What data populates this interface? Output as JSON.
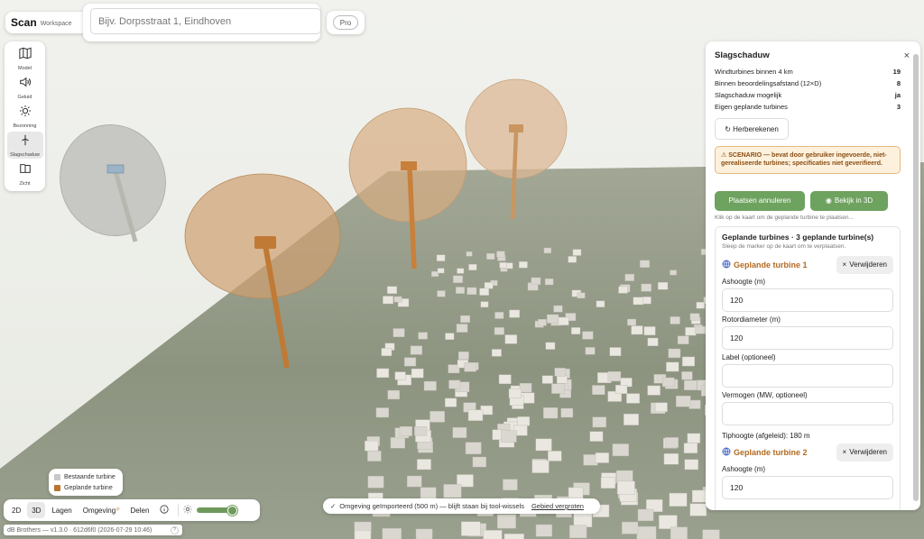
{
  "app": {
    "name": "Scan",
    "subtitle": "Workspace",
    "pro_label": "Pro"
  },
  "search": {
    "placeholder": "Bijv. Dorpsstraat 1, Eindhoven",
    "value": ""
  },
  "left_nav": [
    {
      "label": "Model",
      "icon": "map-icon"
    },
    {
      "label": "Geluid",
      "icon": "speaker-icon"
    },
    {
      "label": "Bezonning",
      "icon": "sun-icon"
    },
    {
      "label": "Slagschaduw",
      "icon": "wind-turbine-icon",
      "active": true
    },
    {
      "label": "Zicht",
      "icon": "map-view-icon"
    }
  ],
  "legend": [
    {
      "label": "Bestaande turbine",
      "color": "#c8c8c8"
    },
    {
      "label": "Geplande turbine",
      "color": "#b8752e"
    }
  ],
  "toolbar": {
    "buttons": [
      "2D",
      "3D",
      "Lagen",
      "Omgeving",
      "Delen"
    ],
    "active": "3D",
    "omgeving_badge": "P"
  },
  "version": "dB Brothers — v1.3.0 · 612d6f0 (2026-07-29 10:46)",
  "version_help": "?",
  "toast": {
    "icon": "✓",
    "text": "Omgeving geïmporteerd (500 m) — blijft staan bij tool-wissels",
    "link": "Gebied vergroten"
  },
  "panel": {
    "title": "Slagschaduw",
    "close": "×",
    "stats": [
      {
        "label": "Windturbines binnen 4 km",
        "value": "19"
      },
      {
        "label": "Binnen beoordelingsafstand (12×D)",
        "value": "8"
      },
      {
        "label": "Slagschaduw mogelijk",
        "value": "ja"
      },
      {
        "label": "Eigen geplande turbines",
        "value": "3"
      }
    ],
    "recalc": "↻ Herberekenen",
    "warning": "⚠ SCENARIO — bevat door gebruiker ingevoerde, niet-gerealiseerde turbines; specificaties niet geverifieerd.",
    "cancel_placing": "Plaatsen annuleren",
    "view_3d": "Bekijk in 3D",
    "hint": "Klik op de kaart om de geplande turbine te plaatsen...",
    "planned_title": "Geplande turbines · 3 geplande turbine(s)",
    "planned_sub": "Sleep de marker op de kaart om te verplaatsen.",
    "turbines": [
      {
        "name": "Geplande turbine 1",
        "delete": "Verwijderen",
        "hub_label": "Ashoogte (m)",
        "hub_value": "120",
        "rotor_label": "Rotordiameter (m)",
        "rotor_value": "120",
        "label_label": "Label (optioneel)",
        "label_value": "",
        "power_label": "Vermogen (MW, optioneel)",
        "power_value": "",
        "tip": "Tiphoogte (afgeleid): 180 m"
      },
      {
        "name": "Geplande turbine 2",
        "delete": "Verwijderen",
        "hub_label": "Ashoogte (m)",
        "hub_value": "120"
      }
    ]
  },
  "colors": {
    "planned": "#b8752e",
    "existing": "#c8c8c8",
    "accent_green": "#6ea25f",
    "terrain": "#8f9784"
  }
}
